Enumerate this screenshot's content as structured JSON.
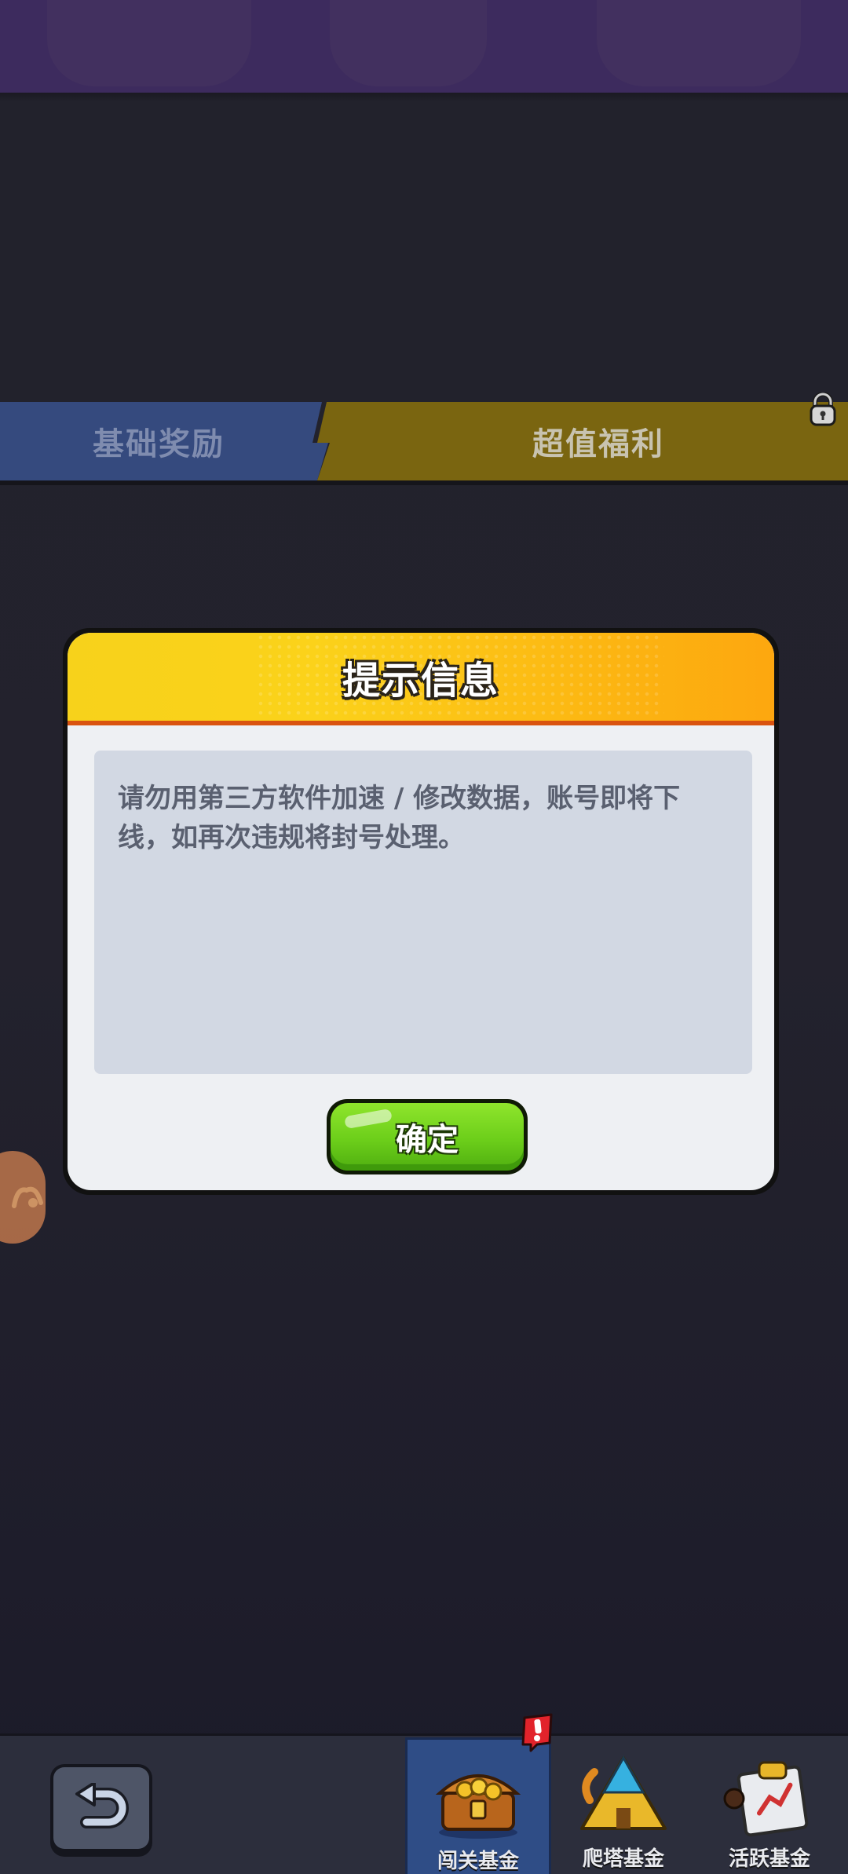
{
  "tabs": {
    "basic_label": "基础奖励",
    "premium_label": "超值福利"
  },
  "dialog": {
    "title": "提示信息",
    "message": "请勿用第三方软件加速 / 修改数据，账号即将下线，如再次违规将封号处理。",
    "confirm_label": "确定"
  },
  "bottom_nav": {
    "items": [
      {
        "label": "闯关基金",
        "icon": "treasure-chest-icon",
        "active": true,
        "badge": "!"
      },
      {
        "label": "爬塔基金",
        "icon": "pyramid-tower-icon",
        "active": false
      },
      {
        "label": "活跃基金",
        "icon": "activity-calendar-icon",
        "active": false
      }
    ],
    "back_icon": "back-arrow-icon"
  },
  "colors": {
    "header_yellow": "#fbd21a",
    "confirm_green": "#6cce1a",
    "tab_basic": "#354a7e",
    "tab_premium": "#7a6510"
  }
}
